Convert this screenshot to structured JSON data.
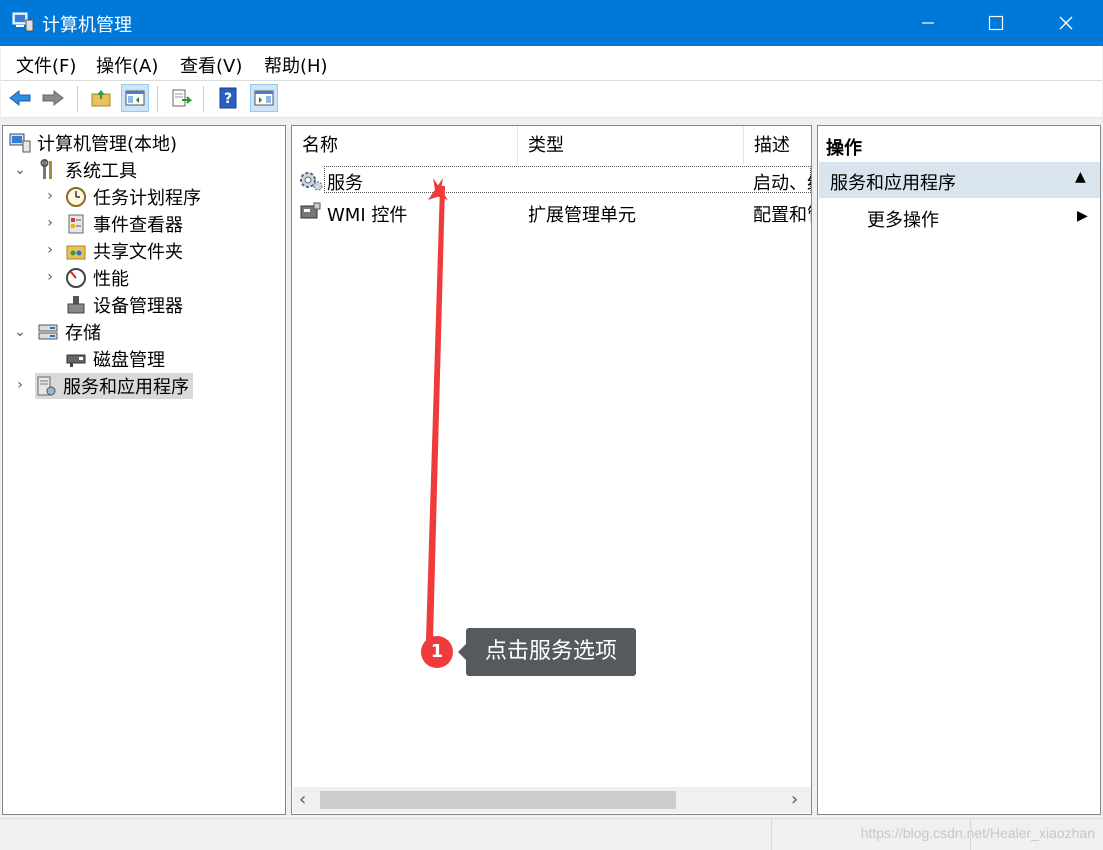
{
  "window": {
    "title": "计算机管理",
    "buttons": {
      "minimize": "—",
      "maximize": "☐",
      "close": "✕"
    }
  },
  "menubar": [
    "文件(F)",
    "操作(A)",
    "查看(V)",
    "帮助(H)"
  ],
  "toolbar": [
    "back-icon",
    "forward-icon",
    "up-folder-icon",
    "show-hide-tree-icon",
    "export-list-icon",
    "help-icon",
    "show-hide-action-pane-icon"
  ],
  "tree": {
    "root": "计算机管理(本地)",
    "items": [
      {
        "label": "系统工具",
        "expanded": true
      },
      {
        "label": "任务计划程序"
      },
      {
        "label": "事件查看器"
      },
      {
        "label": "共享文件夹"
      },
      {
        "label": "性能"
      },
      {
        "label": "设备管理器"
      },
      {
        "label": "存储",
        "expanded": true
      },
      {
        "label": "磁盘管理"
      },
      {
        "label": "服务和应用程序",
        "selected": true
      }
    ]
  },
  "list": {
    "columns": [
      "名称",
      "类型",
      "描述"
    ],
    "rows": [
      {
        "name": "服务",
        "type": "",
        "desc": "启动、约"
      },
      {
        "name": "WMI 控件",
        "type": "扩展管理单元",
        "desc": "配置和管"
      }
    ],
    "scroll_left": "‹",
    "scroll_right": "›"
  },
  "actions": {
    "title": "操作",
    "group": "服务和应用程序",
    "group_toggle": "▲",
    "more": "更多操作",
    "more_arrow": "▶"
  },
  "annotation": {
    "number": "1",
    "text": "点击服务选项"
  },
  "status": {
    "watermark": "https://blog.csdn.net/Healer_xiaozhan"
  },
  "colors": {
    "titlebar": "#0078d7",
    "annotation_red": "#ef3b3b",
    "bubble": "#555a5f"
  }
}
